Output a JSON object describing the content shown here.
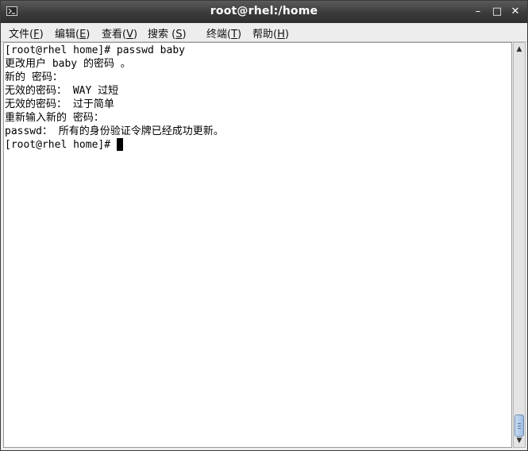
{
  "window": {
    "title": "root@rhel:/home",
    "minimize_glyph": "–",
    "maximize_glyph": "□",
    "close_glyph": "✕"
  },
  "menu": [
    {
      "label": "文件(",
      "mnemonic": "F",
      "suffix": ")"
    },
    {
      "label": "编辑(",
      "mnemonic": "E",
      "suffix": ")"
    },
    {
      "label": "查看(",
      "mnemonic": "V",
      "suffix": ")"
    },
    {
      "label": "搜索 (",
      "mnemonic": "S",
      "suffix": ")"
    },
    {
      "label": "终端(",
      "mnemonic": "T",
      "suffix": ")"
    },
    {
      "label": "帮助(",
      "mnemonic": "H",
      "suffix": ")"
    }
  ],
  "terminal": {
    "lines": [
      "[root@rhel home]# passwd baby",
      "更改用户 baby 的密码 。",
      "新的 密码：",
      "无效的密码： WAY 过短",
      "无效的密码： 过于简单",
      "重新输入新的 密码：",
      "passwd： 所有的身份验证令牌已经成功更新。"
    ],
    "prompt": "[root@rhel home]# "
  },
  "scrollbar": {
    "up_glyph": "▲",
    "down_glyph": "▼"
  }
}
